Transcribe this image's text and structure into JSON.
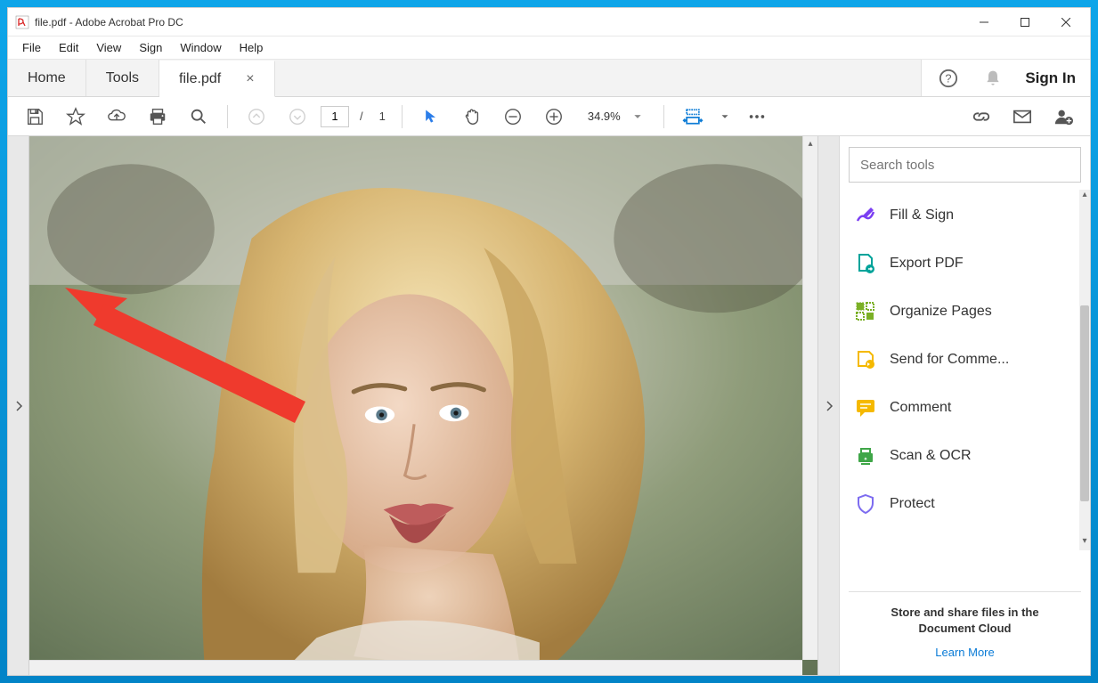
{
  "titlebar": {
    "text": "file.pdf - Adobe Acrobat Pro DC"
  },
  "menubar": {
    "items": [
      "File",
      "Edit",
      "View",
      "Sign",
      "Window",
      "Help"
    ]
  },
  "tabbar": {
    "home": "Home",
    "tools": "Tools",
    "file_tab": "file.pdf",
    "sign_in": "Sign In"
  },
  "toolbar": {
    "page_input": "1",
    "page_sep": "/",
    "page_total": "1",
    "zoom": "34.9%"
  },
  "search": {
    "placeholder": "Search tools"
  },
  "tools_list": [
    {
      "label": "Fill & Sign",
      "color": "#7b3ff2"
    },
    {
      "label": "Export PDF",
      "color": "#00a39a"
    },
    {
      "label": "Organize Pages",
      "color": "#7bb026"
    },
    {
      "label": "Send for Comme...",
      "color": "#f5b900"
    },
    {
      "label": "Comment",
      "color": "#f5b900"
    },
    {
      "label": "Scan & OCR",
      "color": "#3fa648"
    },
    {
      "label": "Protect",
      "color": "#7d6cf0"
    }
  ],
  "footer": {
    "text1": "Store and share files in the",
    "text2": "Document Cloud",
    "learn_more": "Learn More"
  }
}
